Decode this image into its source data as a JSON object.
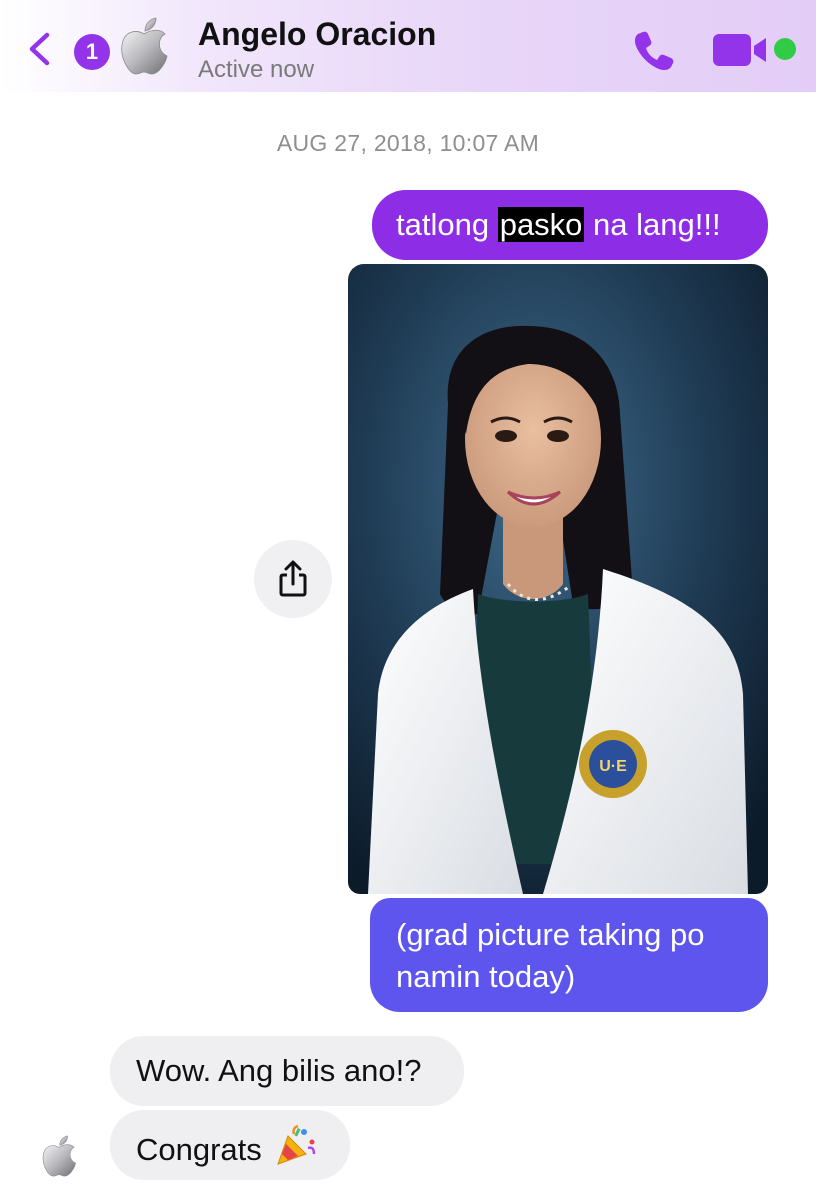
{
  "header": {
    "back_badge": "1",
    "contact_name": "Angelo Oracion",
    "status": "Active now",
    "avatar_icon": "apple-logo-icon",
    "icons": [
      "chevron-left-icon",
      "phone-icon",
      "video-camera-icon"
    ],
    "accent_color": "#9333ea",
    "active_color": "#31cc46"
  },
  "conversation": {
    "timestamp": "AUG 27, 2018, 10:07 AM",
    "messages": [
      {
        "direction": "outgoing",
        "text_before": "tatlong ",
        "highlight": "pasko",
        "text_after": " na lang!!!"
      },
      {
        "direction": "outgoing",
        "type": "photo",
        "share_icon": "share-icon"
      },
      {
        "direction": "outgoing",
        "text": "(grad picture taking po namin today)"
      },
      {
        "direction": "incoming",
        "text": "Wow. Ang bilis ano!?"
      },
      {
        "direction": "incoming",
        "text": "Congrats",
        "emoji_icon": "party-popper-icon"
      }
    ],
    "bubble_colors": {
      "outgoing_top": "#8e2de6",
      "outgoing_bottom": "#5d55ee",
      "incoming": "#efeff1"
    }
  }
}
